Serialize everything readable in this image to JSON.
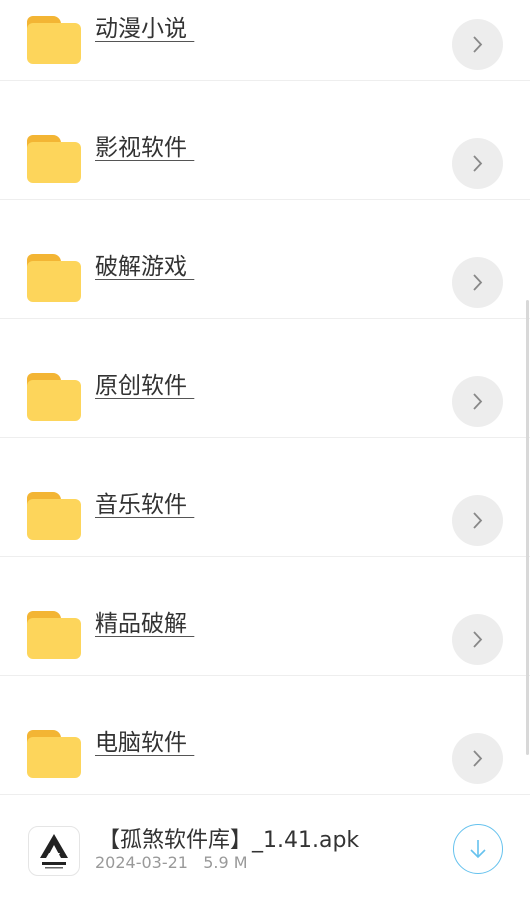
{
  "folders": [
    {
      "label": "动漫小说 ",
      "icon": "folder-icon",
      "action_icon": "chevron-right-icon"
    },
    {
      "label": "影视软件 ",
      "icon": "folder-icon",
      "action_icon": "chevron-right-icon"
    },
    {
      "label": "破解游戏 ",
      "icon": "folder-icon",
      "action_icon": "chevron-right-icon"
    },
    {
      "label": "原创软件 ",
      "icon": "folder-icon",
      "action_icon": "chevron-right-icon"
    },
    {
      "label": "音乐软件 ",
      "icon": "folder-icon",
      "action_icon": "chevron-right-icon"
    },
    {
      "label": "精品破解 ",
      "icon": "folder-icon",
      "action_icon": "chevron-right-icon"
    },
    {
      "label": "电脑软件 ",
      "icon": "folder-icon",
      "action_icon": "chevron-right-icon"
    }
  ],
  "file": {
    "name": "【孤煞软件库】_1.41.apk",
    "date": "2024-03-21",
    "size": "5.9 M",
    "icon": "app-logo-icon",
    "action_icon": "download-icon"
  },
  "colors": {
    "folder_front": "#fdd55b",
    "folder_back": "#f3b534",
    "download_accent": "#66c2ee"
  }
}
